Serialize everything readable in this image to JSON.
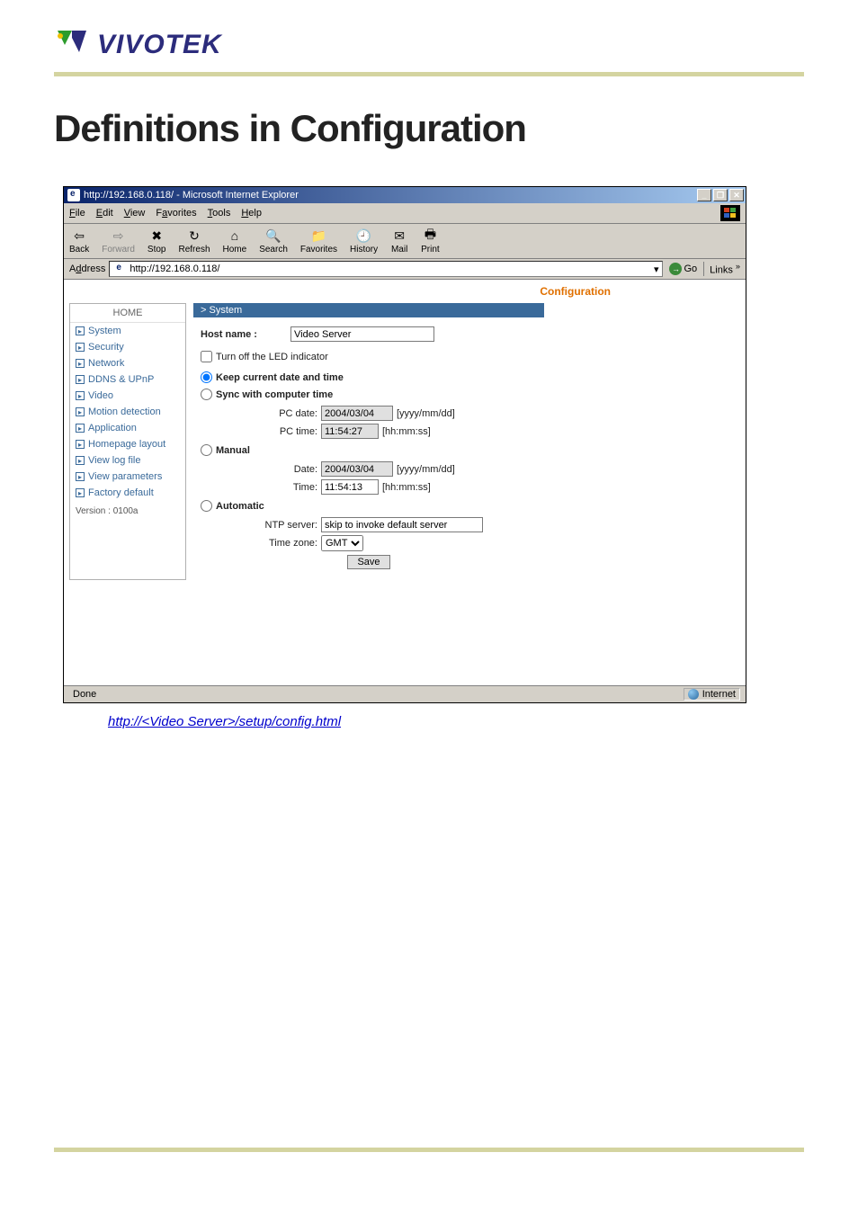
{
  "logo": {
    "brand": "VIVOTEK"
  },
  "doc": {
    "title": "Definitions in Configuration",
    "link_text": "http://<Video Server>/setup/config.html",
    "link_href": "#"
  },
  "ie": {
    "title": "http://192.168.0.118/ - Microsoft Internet Explorer",
    "menu": {
      "file": "File",
      "edit": "Edit",
      "view": "View",
      "favorites": "Favorites",
      "tools": "Tools",
      "help": "Help"
    },
    "toolbar": {
      "back": "Back",
      "forward": "Forward",
      "stop": "Stop",
      "refresh": "Refresh",
      "home": "Home",
      "search": "Search",
      "favorites": "Favorites",
      "history": "History",
      "mail": "Mail",
      "print": "Print"
    },
    "address": {
      "label": "Address",
      "value": "http://192.168.0.118/",
      "go": "Go",
      "links": "Links"
    },
    "status": {
      "done": "Done",
      "zone": "Internet"
    }
  },
  "config": {
    "header_label": "Configuration",
    "sidebar": {
      "home": "HOME",
      "items": [
        "System",
        "Security",
        "Network",
        "DDNS & UPnP",
        "Video",
        "Motion detection",
        "Application",
        "Homepage layout",
        "View log file",
        "View parameters",
        "Factory default"
      ],
      "version": "Version : 0100a"
    },
    "system": {
      "section_title": "> System",
      "host_name_label": "Host name :",
      "host_name_value": "Video Server",
      "led_label": "Turn off the LED indicator",
      "radio_keep": "Keep current date and time",
      "radio_sync": "Sync with computer time",
      "pc_date_label": "PC date:",
      "pc_date_value": "2004/03/04",
      "pc_date_fmt": "[yyyy/mm/dd]",
      "pc_time_label": "PC time:",
      "pc_time_value": "11:54:27",
      "pc_time_fmt": "[hh:mm:ss]",
      "radio_manual": "Manual",
      "m_date_label": "Date:",
      "m_date_value": "2004/03/04",
      "m_date_fmt": "[yyyy/mm/dd]",
      "m_time_label": "Time:",
      "m_time_value": "11:54:13",
      "m_time_fmt": "[hh:mm:ss]",
      "radio_auto": "Automatic",
      "ntp_label": "NTP server:",
      "ntp_value": "skip to invoke default server",
      "tz_label": "Time zone:",
      "tz_value": "GMT",
      "save": "Save"
    }
  }
}
